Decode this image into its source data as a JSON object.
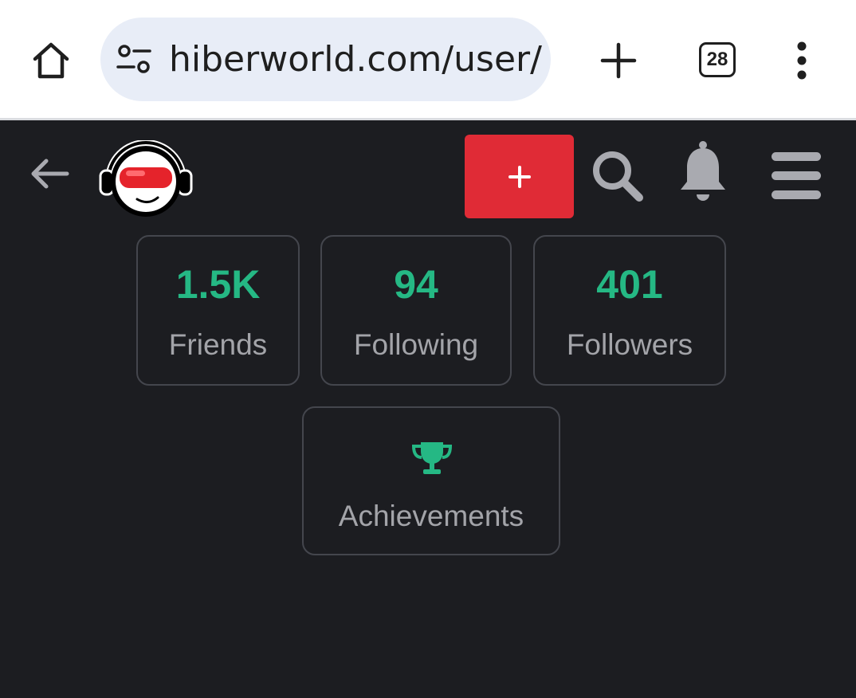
{
  "browser": {
    "url": "hiberworld.com/user/F",
    "tab_count": "28",
    "icons": [
      "home-icon",
      "site-settings-icon",
      "plus-icon",
      "tab-switcher-icon",
      "more-vert-icon"
    ]
  },
  "header": {
    "icons": [
      "back-arrow-icon",
      "avatar-logo",
      "plus-icon",
      "search-icon",
      "bell-icon",
      "hamburger-icon"
    ],
    "create_color": "#e02b36"
  },
  "stats": {
    "friends": {
      "value": "1.5K",
      "label": "Friends"
    },
    "following": {
      "value": "94",
      "label": "Following"
    },
    "followers": {
      "value": "401",
      "label": "Followers"
    },
    "achievements": {
      "label": "Achievements",
      "icon": "trophy-icon"
    }
  },
  "colors": {
    "background": "#1c1d21",
    "accent_green": "#25b884",
    "card_border": "#44464d",
    "label_gray": "#a3a4a9"
  }
}
